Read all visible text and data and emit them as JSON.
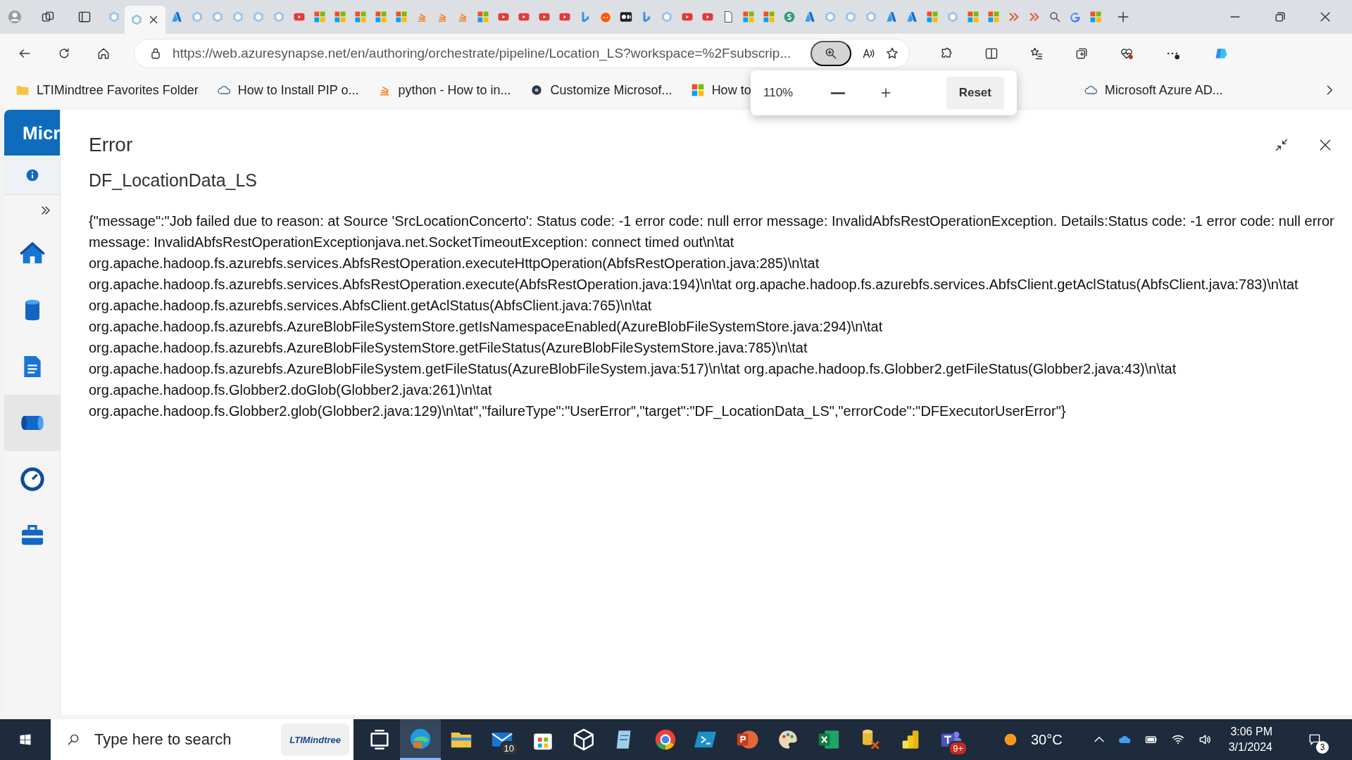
{
  "browser": {
    "tabs": [
      {
        "kind": "synapse",
        "selected": false
      },
      {
        "kind": "synapse",
        "selected": true
      },
      {
        "kind": "azure",
        "selected": false
      },
      {
        "kind": "synapse",
        "selected": false
      },
      {
        "kind": "synapse",
        "selected": false
      },
      {
        "kind": "synapse",
        "selected": false
      },
      {
        "kind": "synapse",
        "selected": false
      },
      {
        "kind": "synapse",
        "selected": false
      },
      {
        "kind": "video",
        "selected": false
      },
      {
        "kind": "tiles",
        "selected": false
      },
      {
        "kind": "tiles",
        "selected": false
      },
      {
        "kind": "tiles",
        "selected": false
      },
      {
        "kind": "tiles",
        "selected": false
      },
      {
        "kind": "tiles",
        "selected": false
      },
      {
        "kind": "stack",
        "selected": false
      },
      {
        "kind": "stack",
        "selected": false
      },
      {
        "kind": "stack",
        "selected": false
      },
      {
        "kind": "tiles",
        "selected": false
      },
      {
        "kind": "video",
        "selected": false
      },
      {
        "kind": "video",
        "selected": false
      },
      {
        "kind": "video",
        "selected": false
      },
      {
        "kind": "video",
        "selected": false
      },
      {
        "kind": "bing",
        "selected": false
      },
      {
        "kind": "reddit",
        "selected": false
      },
      {
        "kind": "dark",
        "selected": false
      },
      {
        "kind": "bing",
        "selected": false
      },
      {
        "kind": "synapse",
        "selected": false
      },
      {
        "kind": "video",
        "selected": false
      },
      {
        "kind": "video",
        "selected": false
      },
      {
        "kind": "page",
        "selected": false
      },
      {
        "kind": "tiles",
        "selected": false
      },
      {
        "kind": "tiles",
        "selected": false
      },
      {
        "kind": "green",
        "selected": false
      },
      {
        "kind": "azure",
        "selected": false
      },
      {
        "kind": "synapse",
        "selected": false
      },
      {
        "kind": "synapse",
        "selected": false
      },
      {
        "kind": "synapse",
        "selected": false
      },
      {
        "kind": "azure",
        "selected": false
      },
      {
        "kind": "azure",
        "selected": false
      },
      {
        "kind": "tiles",
        "selected": false
      },
      {
        "kind": "synapse",
        "selected": false
      },
      {
        "kind": "tiles",
        "selected": false
      },
      {
        "kind": "tiles",
        "selected": false
      },
      {
        "kind": "arrow",
        "selected": false
      },
      {
        "kind": "arrow",
        "selected": false
      },
      {
        "kind": "search",
        "selected": false
      },
      {
        "kind": "google",
        "selected": false
      },
      {
        "kind": "tiles",
        "selected": false
      }
    ],
    "url": "https://web.azuresynapse.net/en/authoring/orchestrate/pipeline/Location_LS?workspace=%2Fsubscrip...",
    "bookmarks": [
      {
        "kind": "folder",
        "label": "LTIMindtree Favorites Folder"
      },
      {
        "kind": "cloud",
        "label": "How to Install PIP o..."
      },
      {
        "kind": "stack",
        "label": "python - How to in..."
      },
      {
        "kind": "gear",
        "label": "Customize Microsof..."
      },
      {
        "kind": "tiles",
        "label": "How to"
      },
      {
        "kind": "cloud",
        "label": "Microsoft Azure AD..."
      }
    ],
    "zoom_popup": {
      "value": "110%",
      "reset": "Reset"
    }
  },
  "app": {
    "header": "Micr",
    "nav": [
      {
        "kind": "home"
      },
      {
        "kind": "data"
      },
      {
        "kind": "develop"
      },
      {
        "kind": "integrate",
        "selected": true
      },
      {
        "kind": "monitor"
      },
      {
        "kind": "manage"
      }
    ]
  },
  "dialog": {
    "title": "Error",
    "subtitle": "DF_LocationData_LS",
    "message": "{\"message\":\"Job failed due to reason: at Source 'SrcLocationConcerto': Status code: -1 error code: null error message: InvalidAbfsRestOperationException. Details:Status code: -1 error code: null error message: InvalidAbfsRestOperationExceptionjava.net.SocketTimeoutException: connect timed out\\n\\tat org.apache.hadoop.fs.azurebfs.services.AbfsRestOperation.executeHttpOperation(AbfsRestOperation.java:285)\\n\\tat org.apache.hadoop.fs.azurebfs.services.AbfsRestOperation.execute(AbfsRestOperation.java:194)\\n\\tat org.apache.hadoop.fs.azurebfs.services.AbfsClient.getAclStatus(AbfsClient.java:783)\\n\\tat org.apache.hadoop.fs.azurebfs.services.AbfsClient.getAclStatus(AbfsClient.java:765)\\n\\tat org.apache.hadoop.fs.azurebfs.AzureBlobFileSystemStore.getIsNamespaceEnabled(AzureBlobFileSystemStore.java:294)\\n\\tat org.apache.hadoop.fs.azurebfs.AzureBlobFileSystemStore.getFileStatus(AzureBlobFileSystemStore.java:785)\\n\\tat org.apache.hadoop.fs.azurebfs.AzureBlobFileSystem.getFileStatus(AzureBlobFileSystem.java:517)\\n\\tat org.apache.hadoop.fs.Globber2.getFileStatus(Globber2.java:43)\\n\\tat org.apache.hadoop.fs.Globber2.doGlob(Globber2.java:261)\\n\\tat org.apache.hadoop.fs.Globber2.glob(Globber2.java:129)\\n\\tat\",\"failureType\":\"UserError\",\"target\":\"DF_LocationData_LS\",\"errorCode\":\"DFExecutorUserError\"}"
  },
  "taskbar": {
    "search_placeholder": "Type here to search",
    "search_logo": "LTIMindtree",
    "apps": [
      {
        "kind": "taskview",
        "active": false
      },
      {
        "kind": "edge",
        "active": true
      },
      {
        "kind": "folder",
        "active": false
      },
      {
        "kind": "mail",
        "active": false,
        "badge": "10"
      },
      {
        "kind": "store",
        "active": false
      },
      {
        "kind": "cube",
        "active": false
      },
      {
        "kind": "notes",
        "active": false
      },
      {
        "kind": "chrome",
        "active": false
      },
      {
        "kind": "terminal",
        "active": false
      },
      {
        "kind": "powerpoint",
        "active": false
      },
      {
        "kind": "paint",
        "active": false
      },
      {
        "kind": "excel",
        "active": false
      },
      {
        "kind": "dbtool",
        "active": false
      },
      {
        "kind": "powerbi",
        "active": false
      },
      {
        "kind": "teams",
        "active": false,
        "badge": "9+"
      }
    ],
    "temperature": "30°C",
    "time": "3:06 PM",
    "date": "3/1/2024",
    "notifications": "3"
  }
}
